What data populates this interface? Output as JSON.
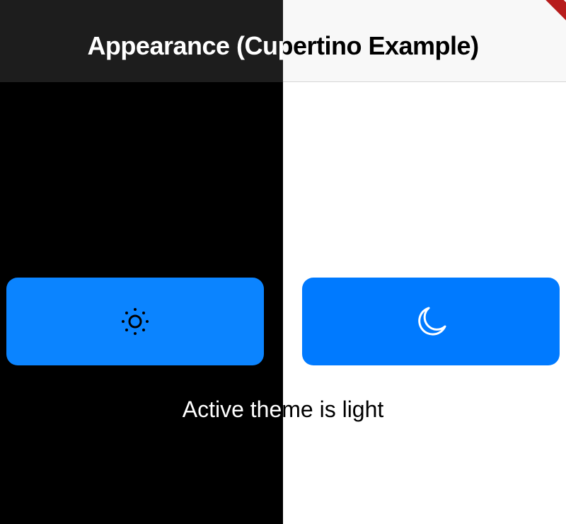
{
  "navbar": {
    "title": "Appearance (Cupertino Example)"
  },
  "buttons": {
    "light_mode": {
      "icon": "sun-icon"
    },
    "dark_mode": {
      "icon": "moon-icon"
    }
  },
  "status": {
    "text": "Active theme is light"
  },
  "colors": {
    "accent": "#007aff",
    "dark_background": "#000000",
    "light_background": "#ffffff",
    "debug_banner": "#b71c1c"
  }
}
